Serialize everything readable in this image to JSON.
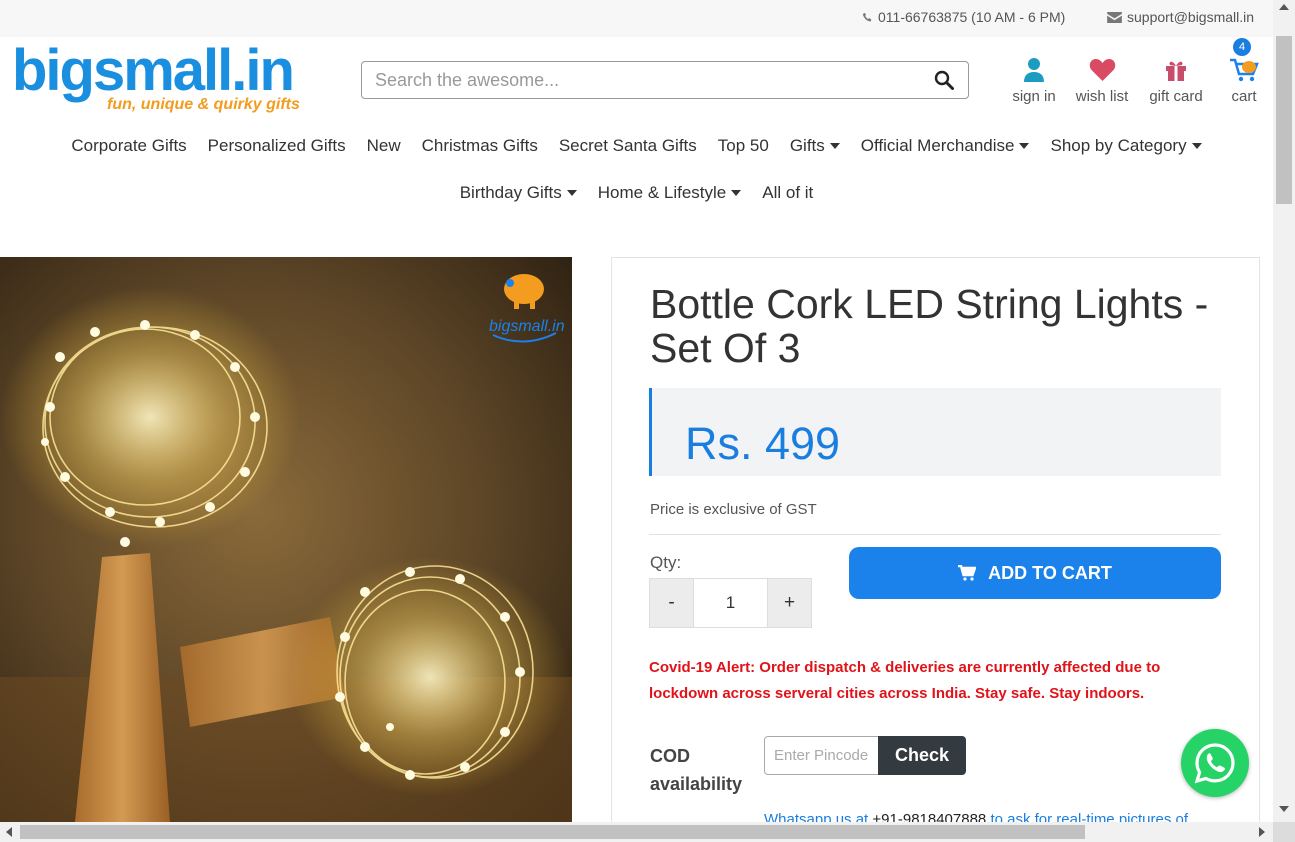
{
  "topbar": {
    "phone": "011-66763875 (10 AM - 6 PM)",
    "email": "support@bigsmall.in"
  },
  "logo": {
    "text": "bigsmall.in",
    "tagline": "fun, unique & quirky gifts"
  },
  "search": {
    "placeholder": "Search the awesome..."
  },
  "header_links": {
    "signin": "sign in",
    "wishlist": "wish list",
    "giftcard": "gift card",
    "cart": "cart",
    "cart_count": "4"
  },
  "nav": {
    "row1": [
      {
        "label": "Corporate Gifts"
      },
      {
        "label": "Personalized Gifts"
      },
      {
        "label": "New"
      },
      {
        "label": "Christmas Gifts"
      },
      {
        "label": "Secret Santa Gifts"
      },
      {
        "label": "Top 50"
      },
      {
        "label": "Gifts"
      },
      {
        "label": "Official Merchandise"
      },
      {
        "label": "Shop by Category"
      }
    ],
    "row2": [
      {
        "label": "Birthday Gifts"
      },
      {
        "label": "Home & Lifestyle"
      },
      {
        "label": "All of it"
      }
    ]
  },
  "product": {
    "image_watermark": "bigsmall.in",
    "title": "Bottle Cork LED String Lights - Set Of 3",
    "price": "Rs. 499",
    "gst_note": "Price is exclusive of GST",
    "qty_label": "Qty:",
    "qty_minus": "-",
    "qty_value": "1",
    "qty_plus": "+",
    "add_to_cart": "ADD TO CART",
    "covid_alert": "Covid-19 Alert: Order dispatch & deliveries are currently affected due to lockdown across serveral cities across India. Stay safe. Stay indoors.",
    "cod_label": "COD availability",
    "pincode_placeholder": "Enter Pincode",
    "check_label": "Check",
    "whatsapp_prefix": "Whatsapp us at ",
    "whatsapp_number": "+91-9818407888",
    "whatsapp_suffix": " to ask for real-time pictures of"
  },
  "colors": {
    "brand_blue": "#1a82ea",
    "logo_orange": "#f39c1f",
    "alert_red": "#e0131a",
    "whatsapp_green": "#25d366"
  }
}
